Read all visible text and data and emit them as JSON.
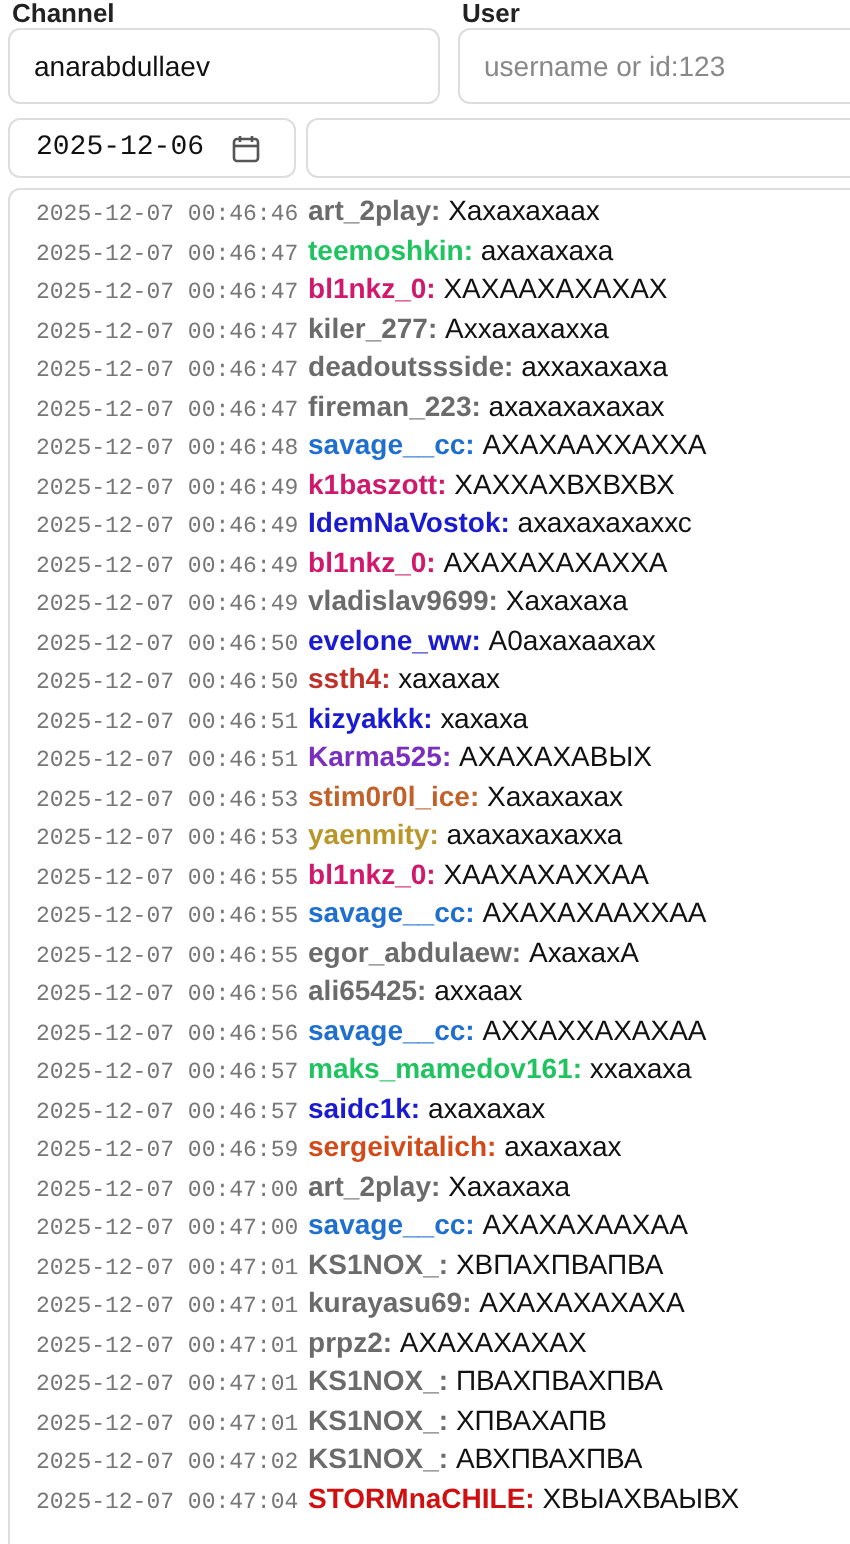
{
  "filters": {
    "channel": {
      "label": "Channel",
      "value": "anarabdullaev"
    },
    "user": {
      "label": "User",
      "placeholder": "username or id:123"
    },
    "date": {
      "value": "2025-12-06"
    }
  },
  "messages": [
    {
      "time": "2025-12-07 00:46:46",
      "user": "art_2play:",
      "color": "#6b6b6b",
      "text": "Хахахахаах"
    },
    {
      "time": "2025-12-07 00:46:47",
      "user": "teemoshkin:",
      "color": "#1fc35f",
      "text": "ахахахаха"
    },
    {
      "time": "2025-12-07 00:46:47",
      "user": "bl1nkz_0:",
      "color": "#d0196d",
      "text": "ХАХААХАХАХАХ"
    },
    {
      "time": "2025-12-07 00:46:47",
      "user": "kiler_277:",
      "color": "#6b6b6b",
      "text": "Аххахахахха"
    },
    {
      "time": "2025-12-07 00:46:47",
      "user": "deadoutssside:",
      "color": "#6b6b6b",
      "text": "аххахахаха"
    },
    {
      "time": "2025-12-07 00:46:47",
      "user": "fireman_223:",
      "color": "#6b6b6b",
      "text": "ахахахахахах"
    },
    {
      "time": "2025-12-07 00:46:48",
      "user": "savage__cc:",
      "color": "#1f6fd0",
      "text": "АХАХААХХАХХА"
    },
    {
      "time": "2025-12-07 00:46:49",
      "user": "k1baszott:",
      "color": "#d0196d",
      "text": "ХАХХАХВХВХВХ"
    },
    {
      "time": "2025-12-07 00:46:49",
      "user": "IdemNaVostok:",
      "color": "#1a1ad0",
      "text": "ахахахахаххс"
    },
    {
      "time": "2025-12-07 00:46:49",
      "user": "bl1nkz_0:",
      "color": "#d0196d",
      "text": "АХАХАХАХАХХА"
    },
    {
      "time": "2025-12-07 00:46:49",
      "user": "vladislav9699:",
      "color": "#6b6b6b",
      "text": "Хахахаха"
    },
    {
      "time": "2025-12-07 00:46:50",
      "user": "evelone_ww:",
      "color": "#1a1ad0",
      "text": "А0ахахаахах"
    },
    {
      "time": "2025-12-07 00:46:50",
      "user": "ssth4:",
      "color": "#c0302b",
      "text": "хахахах"
    },
    {
      "time": "2025-12-07 00:46:51",
      "user": "kizyakkk:",
      "color": "#1a1ad0",
      "text": "хахаха"
    },
    {
      "time": "2025-12-07 00:46:51",
      "user": "Karma525:",
      "color": "#7a2fc0",
      "text": "АХАХАХАВЫХ"
    },
    {
      "time": "2025-12-07 00:46:53",
      "user": "stim0r0l_ice:",
      "color": "#c0622a",
      "text": "Хахахахах"
    },
    {
      "time": "2025-12-07 00:46:53",
      "user": "yaenmity:",
      "color": "#b8962a",
      "text": "ахахахахахха"
    },
    {
      "time": "2025-12-07 00:46:55",
      "user": "bl1nkz_0:",
      "color": "#d0196d",
      "text": "ХААХАХАХХАА"
    },
    {
      "time": "2025-12-07 00:46:55",
      "user": "savage__cc:",
      "color": "#1f6fd0",
      "text": "АХАХАХААХХАА"
    },
    {
      "time": "2025-12-07 00:46:55",
      "user": "egor_abdulaew:",
      "color": "#6b6b6b",
      "text": "АхахахА"
    },
    {
      "time": "2025-12-07 00:46:56",
      "user": "ali65425:",
      "color": "#6b6b6b",
      "text": "аххаах"
    },
    {
      "time": "2025-12-07 00:46:56",
      "user": "savage__cc:",
      "color": "#1f6fd0",
      "text": "АХХАХХАХАХАА"
    },
    {
      "time": "2025-12-07 00:46:57",
      "user": "maks_mamedov161:",
      "color": "#1fc35f",
      "text": "ххахаха"
    },
    {
      "time": "2025-12-07 00:46:57",
      "user": "saidc1k:",
      "color": "#1a1ad0",
      "text": "ахахахах"
    },
    {
      "time": "2025-12-07 00:46:59",
      "user": "sergeivitalich:",
      "color": "#d24a1a",
      "text": "ахахахах"
    },
    {
      "time": "2025-12-07 00:47:00",
      "user": "art_2play:",
      "color": "#6b6b6b",
      "text": "Хахахаха"
    },
    {
      "time": "2025-12-07 00:47:00",
      "user": "savage__cc:",
      "color": "#1f6fd0",
      "text": "АХАХАХААХАА"
    },
    {
      "time": "2025-12-07 00:47:01",
      "user": "KS1NOX_:",
      "color": "#6b6b6b",
      "text": "ХВПАХПВАПВА"
    },
    {
      "time": "2025-12-07 00:47:01",
      "user": "kurayasu69:",
      "color": "#6b6b6b",
      "text": "АХАХАХАХАХА"
    },
    {
      "time": "2025-12-07 00:47:01",
      "user": "prpz2:",
      "color": "#6b6b6b",
      "text": "АХАХАХАХАХ"
    },
    {
      "time": "2025-12-07 00:47:01",
      "user": "KS1NOX_:",
      "color": "#6b6b6b",
      "text": "ПВАХПВАХПВА"
    },
    {
      "time": "2025-12-07 00:47:01",
      "user": "KS1NOX_:",
      "color": "#6b6b6b",
      "text": "ХПВАХАПВ"
    },
    {
      "time": "2025-12-07 00:47:02",
      "user": "KS1NOX_:",
      "color": "#6b6b6b",
      "text": "АВХПВАХПВА"
    },
    {
      "time": "2025-12-07 00:47:04",
      "user": "STORMnaCHILE:",
      "color": "#d01010",
      "text": "ХВЫАХВАЫВХ"
    }
  ]
}
